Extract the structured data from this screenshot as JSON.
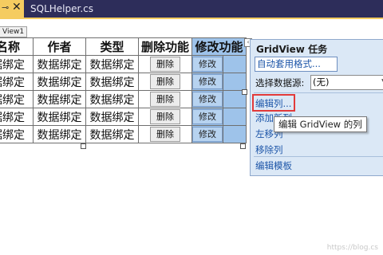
{
  "tabs": {
    "active_close": "✕",
    "file": "SQLHelper.cs"
  },
  "control_tag": "View1",
  "grid": {
    "headers": [
      "名称",
      "作者",
      "类型",
      "删除功能",
      "修改功能"
    ],
    "rows": [
      [
        "据绑定",
        "数据绑定",
        "数据绑定",
        "删除",
        "修改"
      ],
      [
        "据绑定",
        "数据绑定",
        "数据绑定",
        "删除",
        "修改"
      ],
      [
        "据绑定",
        "数据绑定",
        "数据绑定",
        "删除",
        "修改"
      ],
      [
        "据绑定",
        "数据绑定",
        "数据绑定",
        "删除",
        "修改"
      ],
      [
        "据绑定",
        "数据绑定",
        "数据绑定",
        "删除",
        "修改"
      ]
    ]
  },
  "task_panel": {
    "title": "GridView 任务",
    "autoformat": "自动套用格式...",
    "datasource_label": "选择数据源:",
    "datasource_value": "(无)",
    "edit_columns": "编辑列...",
    "add_column": "添加新列...",
    "move_left": "左移列",
    "remove_column": "移除列",
    "edit_templates": "编辑模板"
  },
  "tooltip": "编辑 GridView 的列",
  "watermark": "https://blog.cs",
  "colors": {
    "tab_bar": "#2d2d5a",
    "active_tab": "#f5cc60",
    "panel_bg": "#dbe8f6",
    "link": "#1c55a8",
    "highlight": "#e23a3a",
    "selected_column": "#9ec3ea"
  }
}
